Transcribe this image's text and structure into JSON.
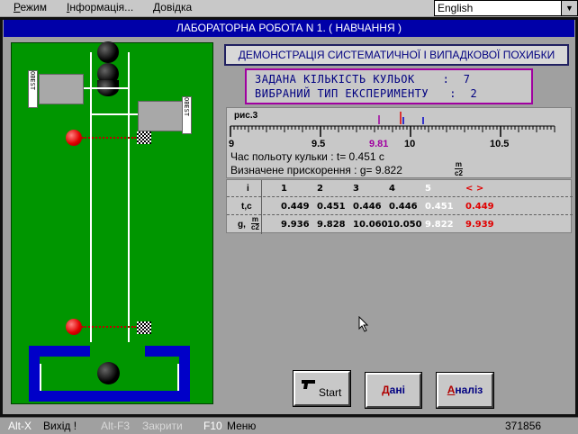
{
  "menu": {
    "items": [
      {
        "accel": "Р",
        "rest": "ежим"
      },
      {
        "accel": "І",
        "rest": "нформація..."
      },
      {
        "accel": "Д",
        "rest": "овідка"
      }
    ]
  },
  "language": {
    "selected": "English"
  },
  "window": {
    "title": "ЛАБОРАТОРНА РОБОТА N 1. ( НАВЧАННЯ )"
  },
  "apparatus": {
    "sensor_label": "OBEST"
  },
  "demo": {
    "title": "ДЕМОНСТРАЦІЯ СИСТЕМАТИЧНОЇ І ВИПАДКОВОЇ ПОХИБКИ"
  },
  "params": {
    "ball_count": "ЗАДАНА КІЛЬКІСТЬ КУЛЬОК    :  7",
    "experiment_type": "ВИБРАНИЙ ТИП ЕКСПЕРИМЕНТУ   :  2"
  },
  "measurement": {
    "figure_label": "рис.3",
    "scale_ticks": [
      "9",
      "9.5",
      "9.81",
      "10",
      "10.5"
    ],
    "marker_value": "9.81",
    "flight_time": "Час польоту кульки : t= 0.451  с",
    "acceleration_prefix": "Визначене прискорення : g= 9.822",
    "accel_unit_num": "m",
    "accel_unit_den": "c2"
  },
  "table": {
    "row_header": "i",
    "row_t": "t,c",
    "row_g_prefix": "g,",
    "row_g_num": "m",
    "row_g_den": "c2",
    "indices": [
      "1",
      "2",
      "3",
      "4",
      "5"
    ],
    "avg_header": "< >",
    "t_values": [
      "0.449",
      "0.451",
      "0.446",
      "0.446",
      "0.451"
    ],
    "t_avg": "0.449",
    "g_values": [
      "9.936",
      "9.828",
      "10.060",
      "10.050",
      "9.822"
    ],
    "g_avg": "9.939"
  },
  "buttons": {
    "start": "Start",
    "data_accel": "Д",
    "data_rest": "ані",
    "analysis_accel": "А",
    "analysis_rest": "наліз"
  },
  "status": {
    "exit_key": "Alt-X",
    "exit_label": "Вихід !",
    "close_key": "Alt-F3",
    "close_label": "Закрити",
    "menu_key": "F10",
    "menu_label": "Меню",
    "counter": "371856"
  },
  "colors": {
    "title_bg": "#0000a8",
    "field": "#009600",
    "accent_red": "#e00000",
    "purple": "#a000a0"
  }
}
